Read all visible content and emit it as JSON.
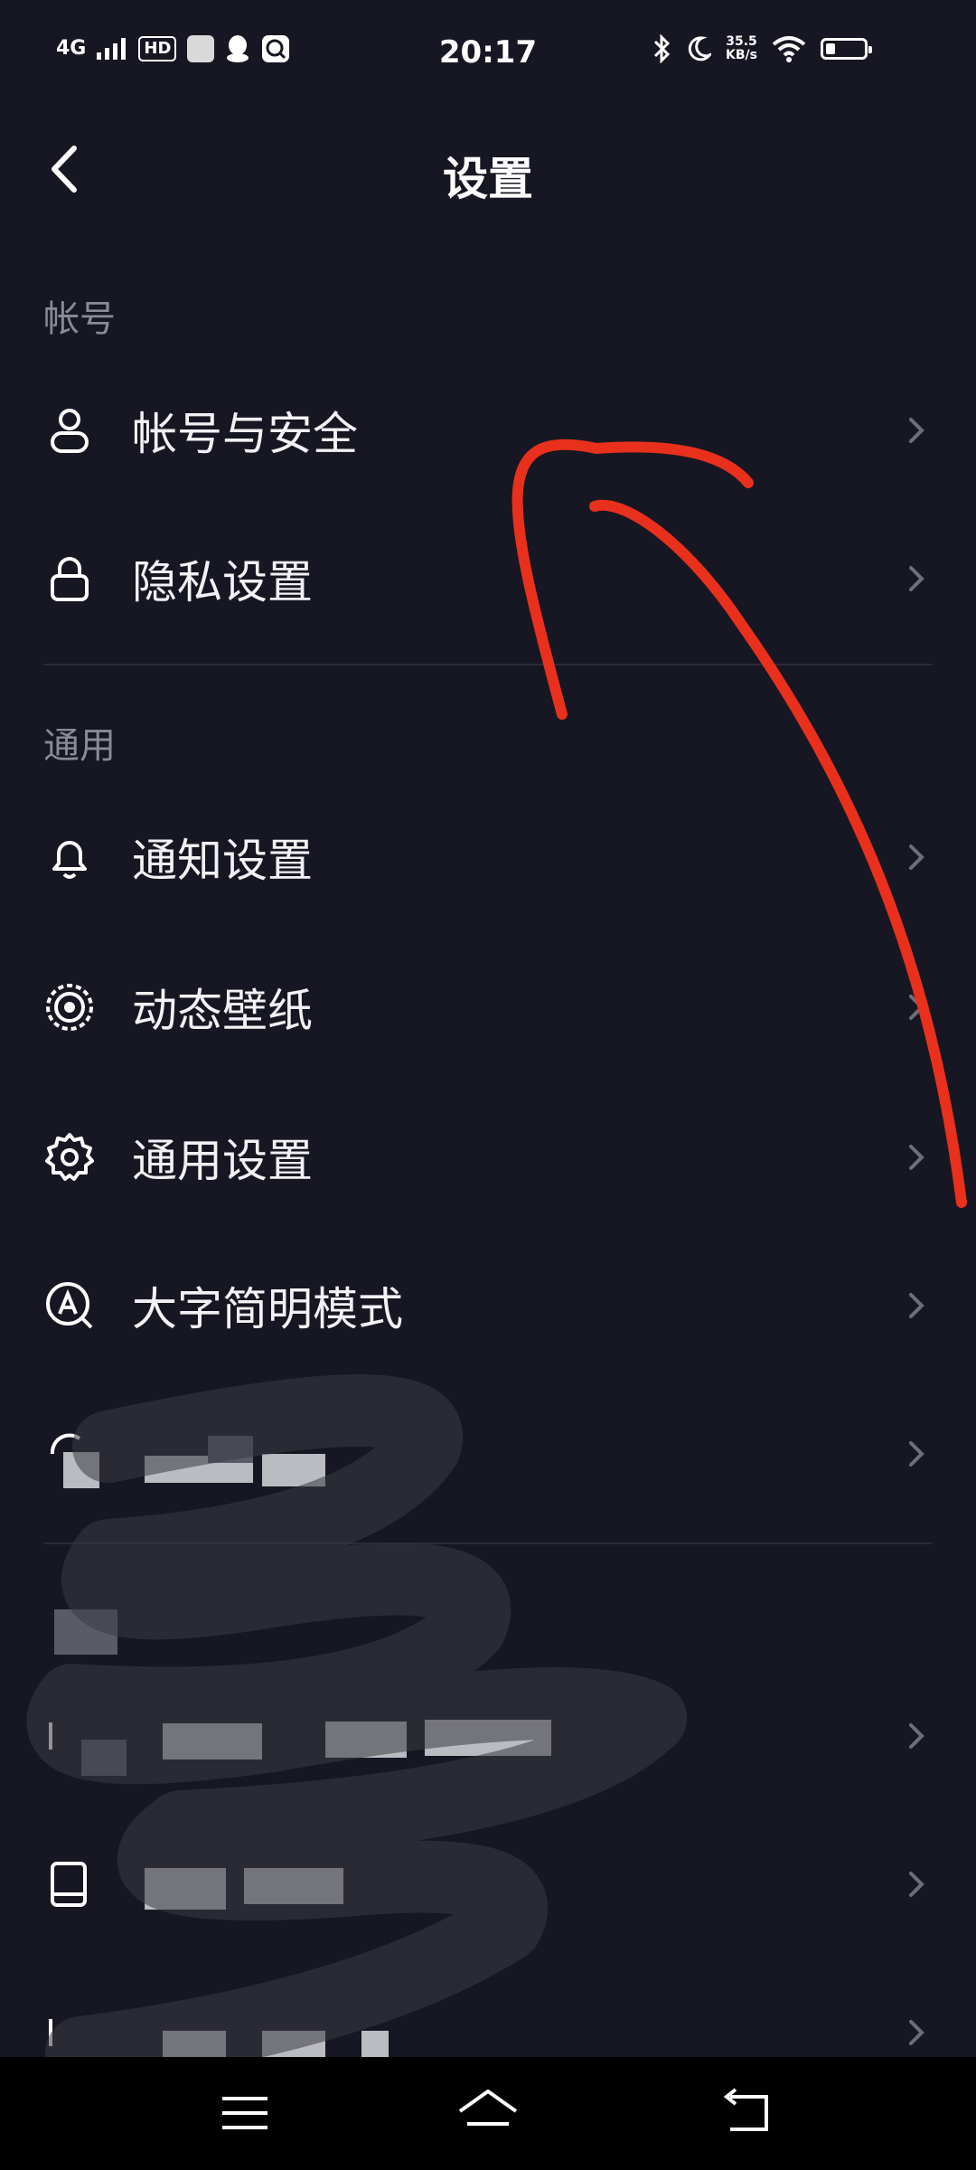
{
  "status_bar": {
    "network": "4G",
    "hd": "HD",
    "time": "20:17",
    "speed_value": "35.5",
    "speed_unit": "KB/s",
    "battery_level": 0.25
  },
  "header": {
    "title": "设置"
  },
  "sections": {
    "account": {
      "label": "帐号",
      "items": [
        {
          "label": "帐号与安全",
          "icon": "user-icon"
        },
        {
          "label": "隐私设置",
          "icon": "lock-icon"
        }
      ]
    },
    "general": {
      "label": "通用",
      "items": [
        {
          "label": "通知设置",
          "icon": "bell-icon"
        },
        {
          "label": "动态壁纸",
          "icon": "wallpaper-icon"
        },
        {
          "label": "通用设置",
          "icon": "gear-icon"
        },
        {
          "label": "大字简明模式",
          "icon": "large-font-icon"
        }
      ]
    }
  },
  "colors": {
    "background": "#161722",
    "annotation": "#e8301c",
    "section_label": "#8a8b96"
  }
}
